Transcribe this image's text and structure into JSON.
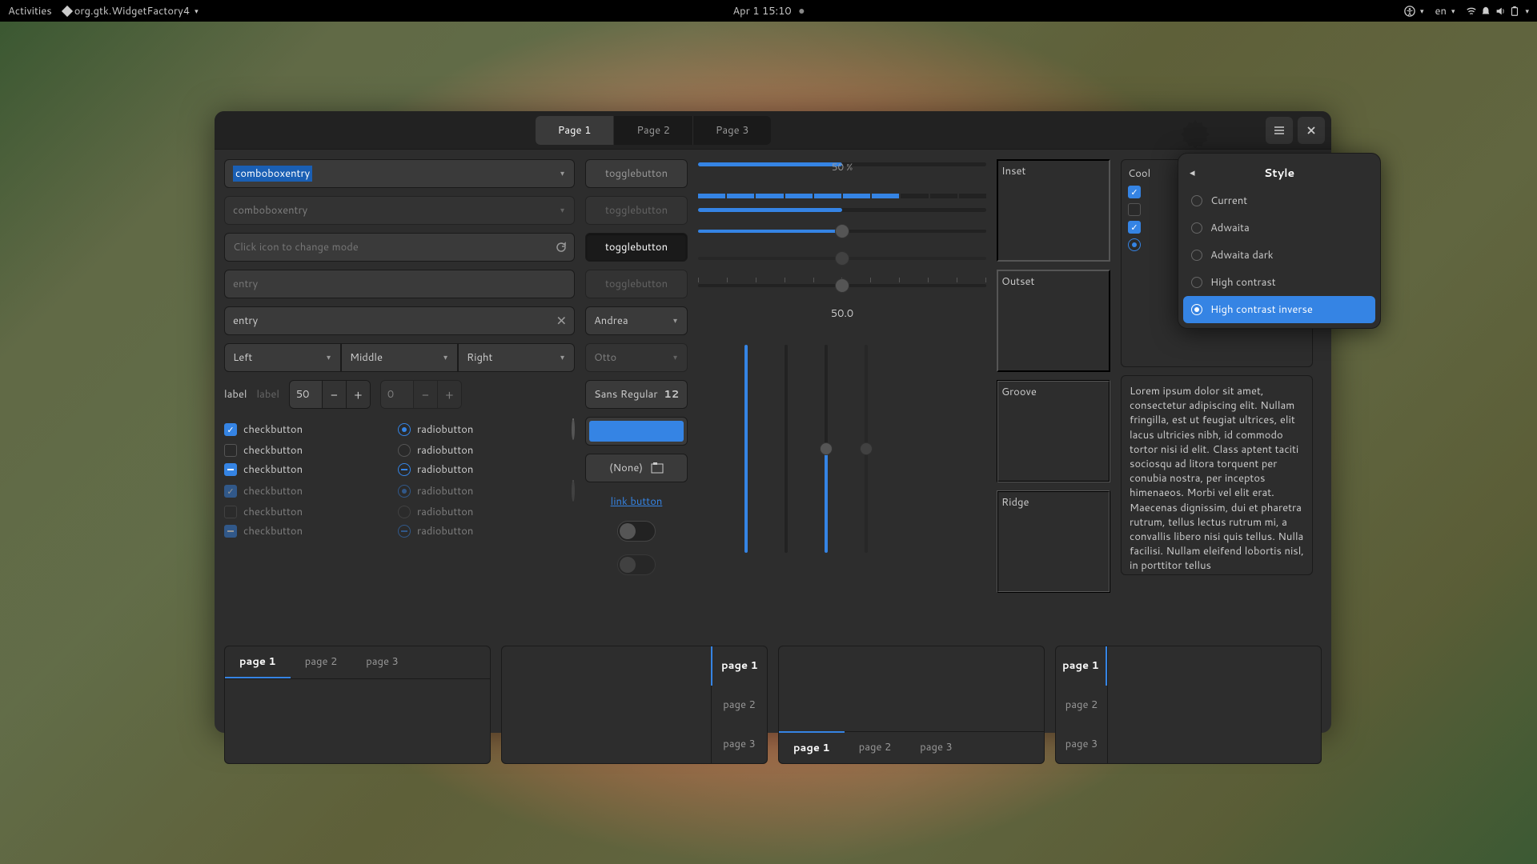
{
  "topbar": {
    "activities": "Activities",
    "app": "org.gtk.WidgetFactory4",
    "clock": "Apr 1  15:10",
    "lang": "en"
  },
  "window": {
    "tabs": [
      "Page 1",
      "Page 2",
      "Page 3"
    ],
    "col1": {
      "combo1": "comboboxentry",
      "combo2": "comboboxentry",
      "mode_placeholder": "Click icon to change mode",
      "entry_placeholder": "entry",
      "entry_value": "entry",
      "triple": [
        "Left",
        "Middle",
        "Right"
      ],
      "label1": "label",
      "label2": "label",
      "spin1": "50",
      "spin2": "0",
      "checkbutton": "checkbutton",
      "radiobutton": "radiobutton"
    },
    "col2": {
      "toggle": "togglebutton",
      "combo_andrea": "Andrea",
      "combo_otto": "Otto",
      "font_name": "Sans Regular",
      "font_size": "12",
      "file_none": "(None)",
      "link": "link button"
    },
    "col3": {
      "prog_label": "50 %",
      "scale_val": "50.0"
    },
    "frames": [
      "Inset",
      "Outset",
      "Groove",
      "Ridge"
    ],
    "checklist": [
      "Cool"
    ],
    "lorem": "Lorem ipsum dolor sit amet, consectetur adipiscing elit. Nullam fringilla, est ut feugiat ultrices, elit lacus ultricies nibh, id commodo tortor nisi id elit. Class aptent taciti sociosqu ad litora torquent per conubia nostra, per inceptos himenaeos. Morbi vel elit erat. Maecenas dignissim, dui et pharetra rutrum, tellus lectus rutrum mi, a convallis libero nisi quis tellus. Nulla facilisi. Nullam eleifend lobortis nisl, in porttitor tellus",
    "notebooks": {
      "pages": [
        "page 1",
        "page 2",
        "page 3"
      ]
    },
    "popover": {
      "title": "Style",
      "options": [
        "Current",
        "Adwaita",
        "Adwaita dark",
        "High contrast",
        "High contrast inverse"
      ]
    }
  }
}
